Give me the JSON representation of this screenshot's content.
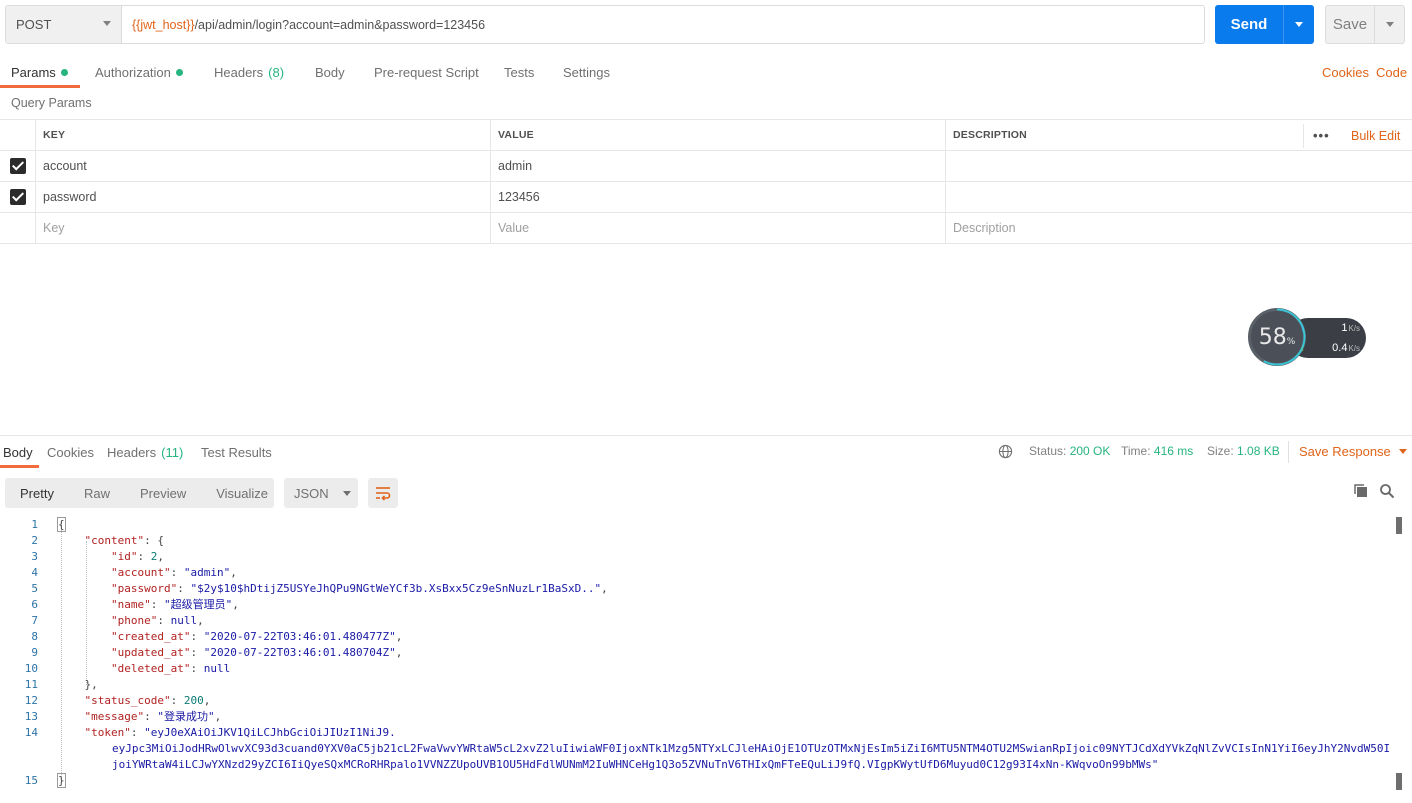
{
  "request": {
    "method": "POST",
    "url_var": "{{jwt_host}}",
    "url_rest": "/api/admin/login?account=admin&password=123456",
    "send_label": "Send",
    "save_label": "Save"
  },
  "req_tabs": {
    "params": "Params",
    "authorization": "Authorization",
    "headers": "Headers",
    "headers_count": "(8)",
    "body": "Body",
    "prerequest": "Pre-request Script",
    "tests": "Tests",
    "settings": "Settings",
    "cookies": "Cookies",
    "code": "Code"
  },
  "query_params": {
    "label": "Query Params",
    "col_key": "KEY",
    "col_value": "VALUE",
    "col_desc": "DESCRIPTION",
    "more": "•••",
    "bulk_edit": "Bulk Edit",
    "rows": [
      {
        "key": "account",
        "value": "admin",
        "checked": true
      },
      {
        "key": "password",
        "value": "123456",
        "checked": true
      }
    ],
    "ph_key": "Key",
    "ph_value": "Value",
    "ph_desc": "Description"
  },
  "net_widget": {
    "percent": "58",
    "percent_unit": "%",
    "percent_value": 0.58,
    "up": "1",
    "down": "0.4",
    "unit": "K/s"
  },
  "response": {
    "tab_body": "Body",
    "tab_cookies": "Cookies",
    "tab_headers": "Headers",
    "headers_count": "(11)",
    "tab_tests": "Test Results",
    "status_label": "Status:",
    "status_value": "200 OK",
    "time_label": "Time:",
    "time_value": "416 ms",
    "size_label": "Size:",
    "size_value": "1.08 KB",
    "save_response": "Save Response",
    "view_pretty": "Pretty",
    "view_raw": "Raw",
    "view_preview": "Preview",
    "view_visualize": "Visualize",
    "format": "JSON"
  },
  "code": {
    "id": "2",
    "account": "\"admin\"",
    "password": "\"$2y$10$hDtijZ5USYeJhQPu9NGtWeYCf3b.XsBxx5Cz9eSnNuzLr1BaSxD..\"",
    "name": "\"超级管理员\"",
    "phone": "null",
    "created_at": "\"2020-07-22T03:46:01.480477Z\"",
    "updated_at": "\"2020-07-22T03:46:01.480704Z\"",
    "deleted_at": "null",
    "status_code": "200",
    "message": "\"登录成功\"",
    "token_1": "\"eyJ0eXAiOiJKV1QiLCJhbGciOiJIUzI1NiJ9.",
    "token_2": "eyJpc3MiOiJodHRwOlwvXC93d3cuand0YXV0aC5jb21cL2FwaVwvYWRtaW5cL2xvZ2luIiwiaWF0IjoxNTk1Mzg5NTYxLCJleHAiOjE1OTUzOTMxNjEsIm5iZiI6MTU5NTM4OTU2MSwianRpIjoic09NYTJCdXdYVkZqNlZvVCIsInN1YiI6eyJhY2NvdW50IjoiYWRtaW4iLCJwYXNzd29yZCI6IiQyeSQxMCRoRHRpalo1VVNZZUpoUVB1OU5HdFdlWUNmM2IuWHNCeHg1Q3o5ZVNuTnV6THIxQmFTeEQuLiJ9fQ.VIgpKWytUfD6Muyud0C12g93I4xNn-KWqvoOn99bMWs\""
  }
}
